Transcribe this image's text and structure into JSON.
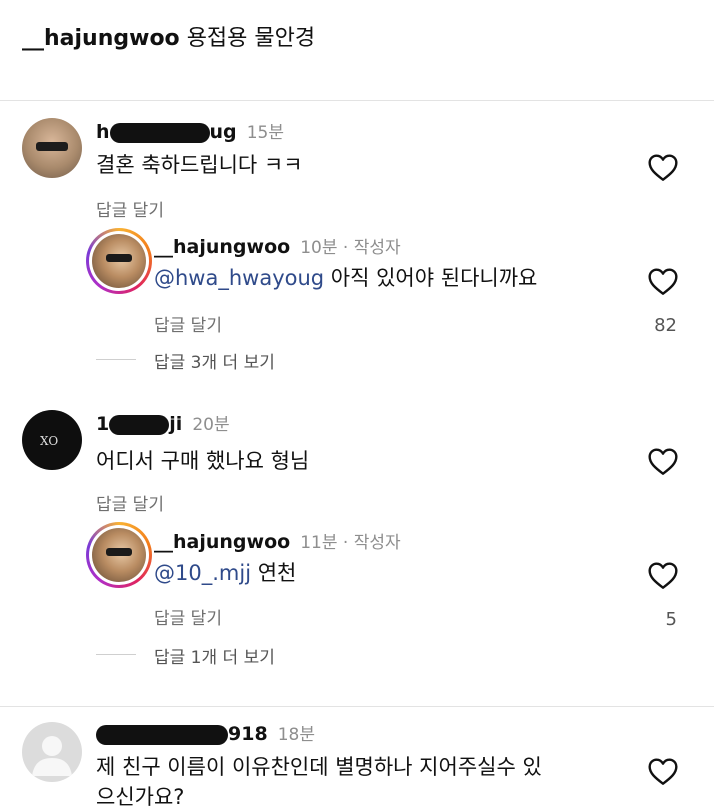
{
  "caption": {
    "username": "__hajungwoo",
    "text": "용접용 물안경"
  },
  "comments": [
    {
      "username_visible_start": "h",
      "username_visible_end": "ug",
      "time": "15분",
      "text": "결혼 축하드립니다 ㅋㅋ",
      "reply_label": "답글 달기",
      "reply": {
        "username": "__hajungwoo",
        "meta": "10분 · 작성자",
        "mention": "@hwa_hwayoug",
        "text": " 아직 있어야 된다니까요",
        "reply_label": "답글 달기",
        "likes": "82",
        "view_more": "답글 3개 더 보기"
      }
    },
    {
      "username_visible_start": "1",
      "username_visible_end": "ji",
      "time": "20분",
      "text": "어디서 구매 했나요 형님",
      "reply_label": "답글 달기",
      "reply": {
        "username": "__hajungwoo",
        "meta": "11분 · 작성자",
        "mention": "@10_.mjj",
        "text": " 연천",
        "reply_label": "답글 달기",
        "likes": "5",
        "view_more": "답글 1개 더 보기"
      }
    },
    {
      "username_visible_start": "",
      "username_visible_end": "918",
      "time": "18분",
      "text_line1": "제 친구 이름이 이유찬인데 별명하나 지어주실수 있",
      "text_line2": "으신가요?"
    }
  ],
  "icons": {
    "like": "heart-outline-icon",
    "avatar_default": "person-icon"
  }
}
